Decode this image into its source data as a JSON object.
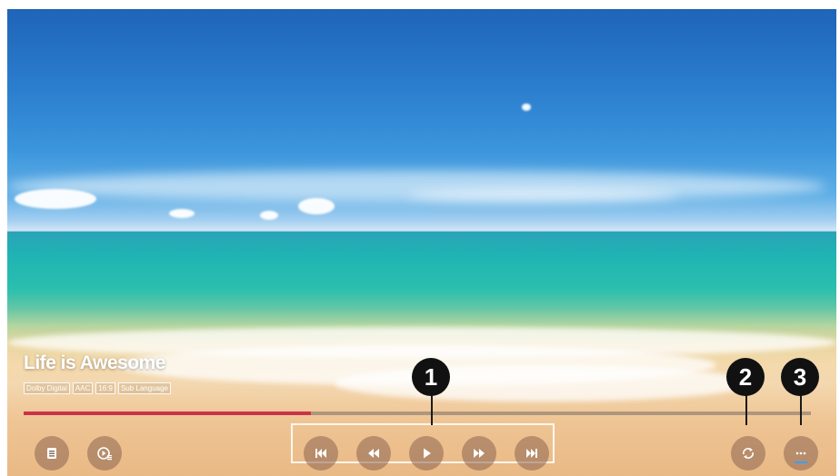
{
  "video": {
    "title": "Life is Awesome",
    "badges": [
      "Dolby Digital",
      "AAC",
      "16:9",
      "Sub Language"
    ],
    "progress": 0.365
  },
  "controls": {
    "left": [
      {
        "name": "playlist-button",
        "icon": "list-icon"
      },
      {
        "name": "playback-settings-button",
        "icon": "play-settings-icon"
      }
    ],
    "center": [
      {
        "name": "previous-button",
        "icon": "skip-previous-icon"
      },
      {
        "name": "rewind-button",
        "icon": "rewind-icon"
      },
      {
        "name": "play-button",
        "icon": "play-icon"
      },
      {
        "name": "fast-forward-button",
        "icon": "fast-forward-icon"
      },
      {
        "name": "next-button",
        "icon": "skip-next-icon"
      }
    ],
    "right": [
      {
        "name": "repeat-button",
        "icon": "repeat-icon"
      },
      {
        "name": "more-button",
        "icon": "more-icon"
      }
    ]
  },
  "callouts": [
    "1",
    "2",
    "3"
  ],
  "colors": {
    "progress": "#c8344a",
    "callout": "#111111",
    "accent": "#3aa0ff"
  }
}
